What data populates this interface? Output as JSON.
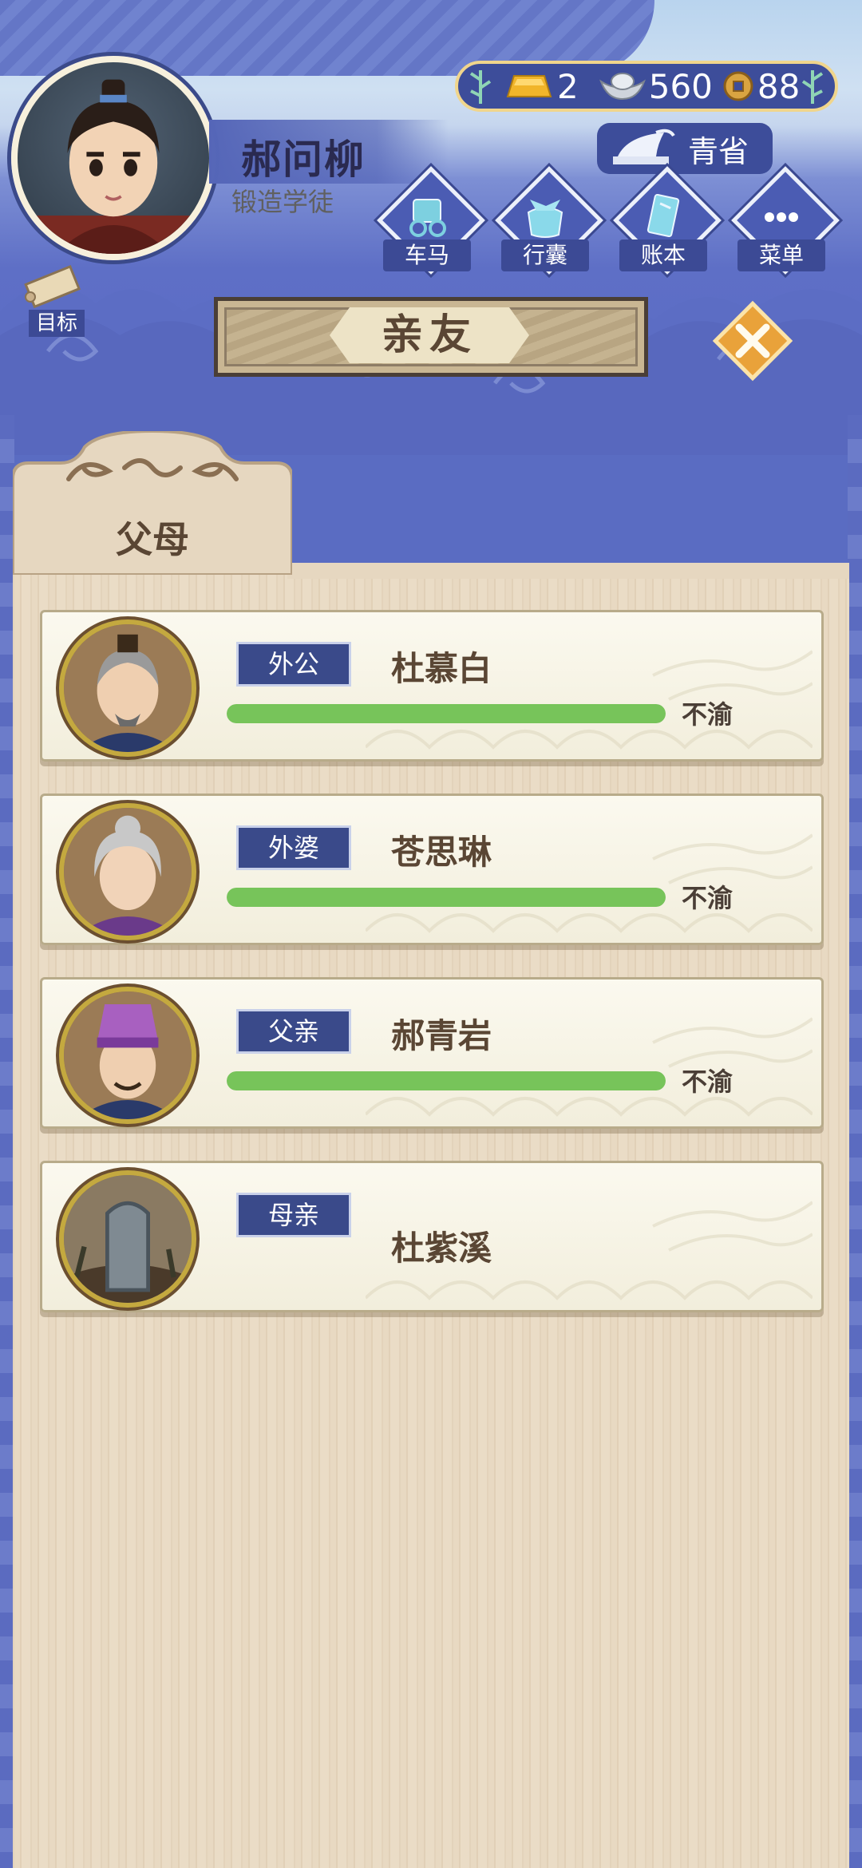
{
  "player": {
    "name": "郝问柳",
    "title": "锻造学徒"
  },
  "currency": {
    "gold": "2",
    "silver": "560",
    "coins": "88"
  },
  "region": {
    "label": "青省"
  },
  "nav": {
    "items": [
      {
        "label": "车马",
        "icon": "carriage-icon"
      },
      {
        "label": "行囊",
        "icon": "bundle-icon"
      },
      {
        "label": "账本",
        "icon": "ledger-icon"
      },
      {
        "label": "菜单",
        "icon": "menu-dots-icon"
      }
    ]
  },
  "goal": {
    "label": "目标"
  },
  "page": {
    "title": "亲友"
  },
  "tabs": [
    {
      "label": "父母",
      "active": true
    }
  ],
  "relatives": [
    {
      "relation": "外公",
      "name": "杜慕白",
      "mood": "不渝",
      "affinity": 1.0
    },
    {
      "relation": "外婆",
      "name": "苍思琳",
      "mood": "不渝",
      "affinity": 1.0
    },
    {
      "relation": "父亲",
      "name": "郝青岩",
      "mood": "不渝",
      "affinity": 1.0
    },
    {
      "relation": "母亲",
      "name": "杜紫溪",
      "mood": "",
      "affinity": null,
      "deceased": true
    }
  ],
  "colors": {
    "accent_blue": "#3a4a8a",
    "affinity_green": "#77c45a",
    "gold_border": "#f0d58c",
    "panel_wood": "#e3d3bb"
  }
}
